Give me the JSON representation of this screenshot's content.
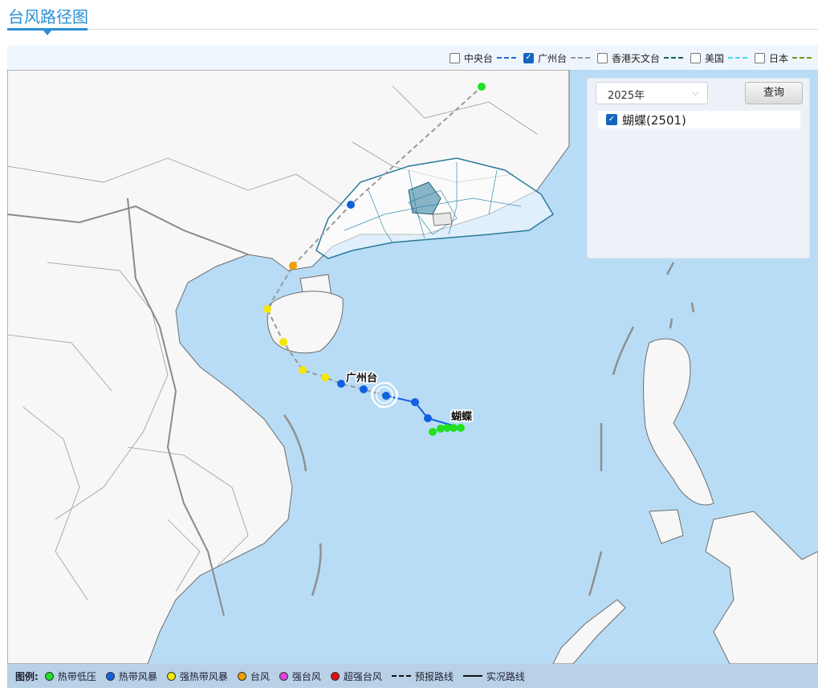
{
  "page_title": "台风路径图",
  "sources": [
    {
      "label": "中央台",
      "checked": false,
      "color": "#1f6fd6"
    },
    {
      "label": "广州台",
      "checked": true,
      "color": "#999999"
    },
    {
      "label": "香港天文台",
      "checked": false,
      "color": "#1a5e5e"
    },
    {
      "label": "美国",
      "checked": false,
      "color": "#49d6f0"
    },
    {
      "label": "日本",
      "checked": false,
      "color": "#6e9a16"
    }
  ],
  "panel": {
    "year": "2025年",
    "query_label": "查询",
    "storms": [
      {
        "label": "蝴蝶(2501)",
        "checked": true
      }
    ]
  },
  "map_labels": {
    "forecast_agency": "广州台",
    "storm_name": "蝴蝶"
  },
  "intensity_colors": {
    "tropical_depression": "#22e022",
    "tropical_storm": "#1060e0",
    "severe_tropical_storm": "#f4e800",
    "typhoon": "#f0a000",
    "severe_typhoon": "#e040e0",
    "super_typhoon": "#e01010"
  },
  "legend": {
    "title": "图例:",
    "items": [
      {
        "label": "热带低压",
        "color": "#22e022",
        "kind": "dot"
      },
      {
        "label": "热带风暴",
        "color": "#1060e0",
        "kind": "dot"
      },
      {
        "label": "强热带风暴",
        "color": "#f4e800",
        "kind": "dot"
      },
      {
        "label": "台风",
        "color": "#f0a000",
        "kind": "dot"
      },
      {
        "label": "强台风",
        "color": "#e040e0",
        "kind": "dot"
      },
      {
        "label": "超强台风",
        "color": "#e01010",
        "kind": "dot"
      },
      {
        "label": "预报路线",
        "kind": "dashed"
      },
      {
        "label": "实况路线",
        "kind": "solid"
      }
    ]
  }
}
